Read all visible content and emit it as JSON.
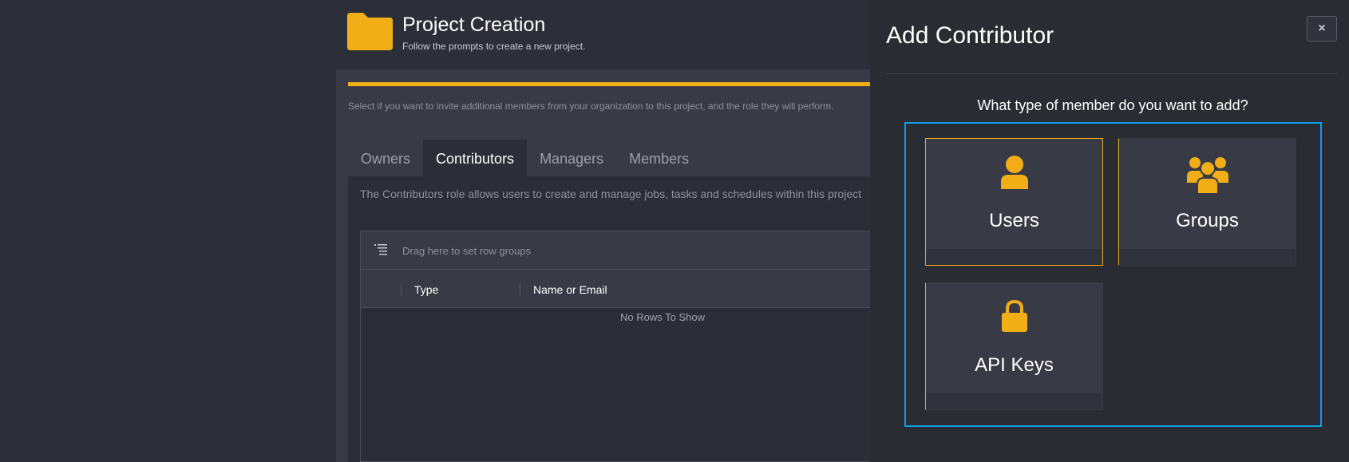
{
  "colors": {
    "accent": "#f2ae17",
    "highlight": "#129ee5",
    "background": "#2c2f38",
    "drawer": "#2a2c34"
  },
  "header": {
    "icon": "folder-icon",
    "title": "Project Creation",
    "subtitle": "Follow the prompts to create a new project."
  },
  "wizard": {
    "progress": 1.0,
    "instructions": "Select if you want to invite additional members from your organization to this project, and the role they will perform.",
    "tabs": [
      {
        "label": "Owners",
        "active": false
      },
      {
        "label": "Contributors",
        "active": true
      },
      {
        "label": "Managers",
        "active": false
      },
      {
        "label": "Members",
        "active": false
      }
    ],
    "role_description": "The Contributors role allows users to create and manage jobs, tasks and schedules within this project",
    "grid": {
      "row_group_placeholder": "Drag here to set row groups",
      "columns": [
        "Type",
        "Name or Email"
      ],
      "empty_message": "No Rows To Show"
    }
  },
  "drawer": {
    "title": "Add Contributor",
    "close_label": "×",
    "question": "What type of member do you want to add?",
    "options": [
      {
        "label": "Users",
        "icon": "user-icon",
        "selected": true
      },
      {
        "label": "Groups",
        "icon": "group-icon",
        "selected": false
      },
      {
        "label": "API Keys",
        "icon": "lock-icon",
        "selected": false
      }
    ]
  }
}
